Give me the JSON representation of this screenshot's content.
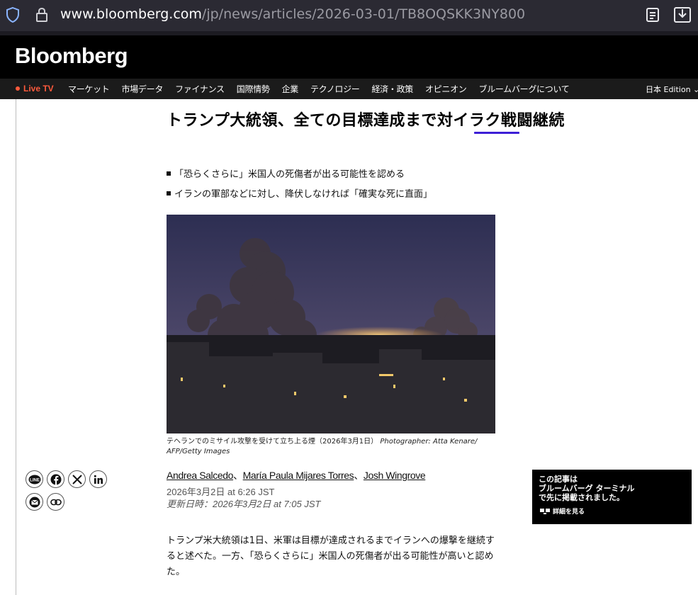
{
  "browser": {
    "url_host": "www.bloomberg.com",
    "url_path": "/jp/news/articles/2026-03-01/TB8OQSKK3NY800"
  },
  "header": {
    "logo": "Bloomberg"
  },
  "nav": {
    "live_label": "Live TV",
    "items": [
      "マーケット",
      "市場データ",
      "ファイナンス",
      "国際情勢",
      "企業",
      "テクノロジー",
      "経済・政策",
      "オピニオン",
      "ブルームバーグについて"
    ],
    "edition": "日本 Edition ⌄"
  },
  "article": {
    "headline": "トランプ大統領、全ての目標達成まで対イラク戦闘継続",
    "bullets": [
      "「恐らくさらに」米国人の死傷者が出る可能性を認める",
      "イランの軍部などに対し、降伏しなければ「確実な死に直面」"
    ],
    "caption": "テヘランでのミサイル攻撃を受けて立ち上る煙（2026年3月1日）",
    "credit": "Photographer: Atta Kenare/ AFP/Getty Images",
    "authors": [
      "Andrea Salcedo",
      "María Paula Mijares Torres",
      "Josh Wingrove"
    ],
    "author_sep": "、",
    "published": "2026年3月2日 at 6:26 JST",
    "updated": "更新日時：2026年3月2日 at 7:05 JST",
    "body": "トランプ米大統領は1日、米軍は目標が達成されるまでイランへの爆撃を継続すると述べた。一方、「恐らくさらに」米国人の死傷者が出る可能性が高いと認めた。"
  },
  "share": {
    "icons": [
      "line-icon",
      "facebook-icon",
      "x-icon",
      "linkedin-icon",
      "mail-icon",
      "link-icon"
    ],
    "line_text": "LINE"
  },
  "terminal": {
    "line1": "この記事は",
    "line2": "ブルームバーグ ターミナル",
    "line3": "で先に掲載されました。",
    "more": "詳細を見る"
  },
  "colors": {
    "accent_underline": "#3d1fd6",
    "live_red": "#ff5a3c"
  }
}
